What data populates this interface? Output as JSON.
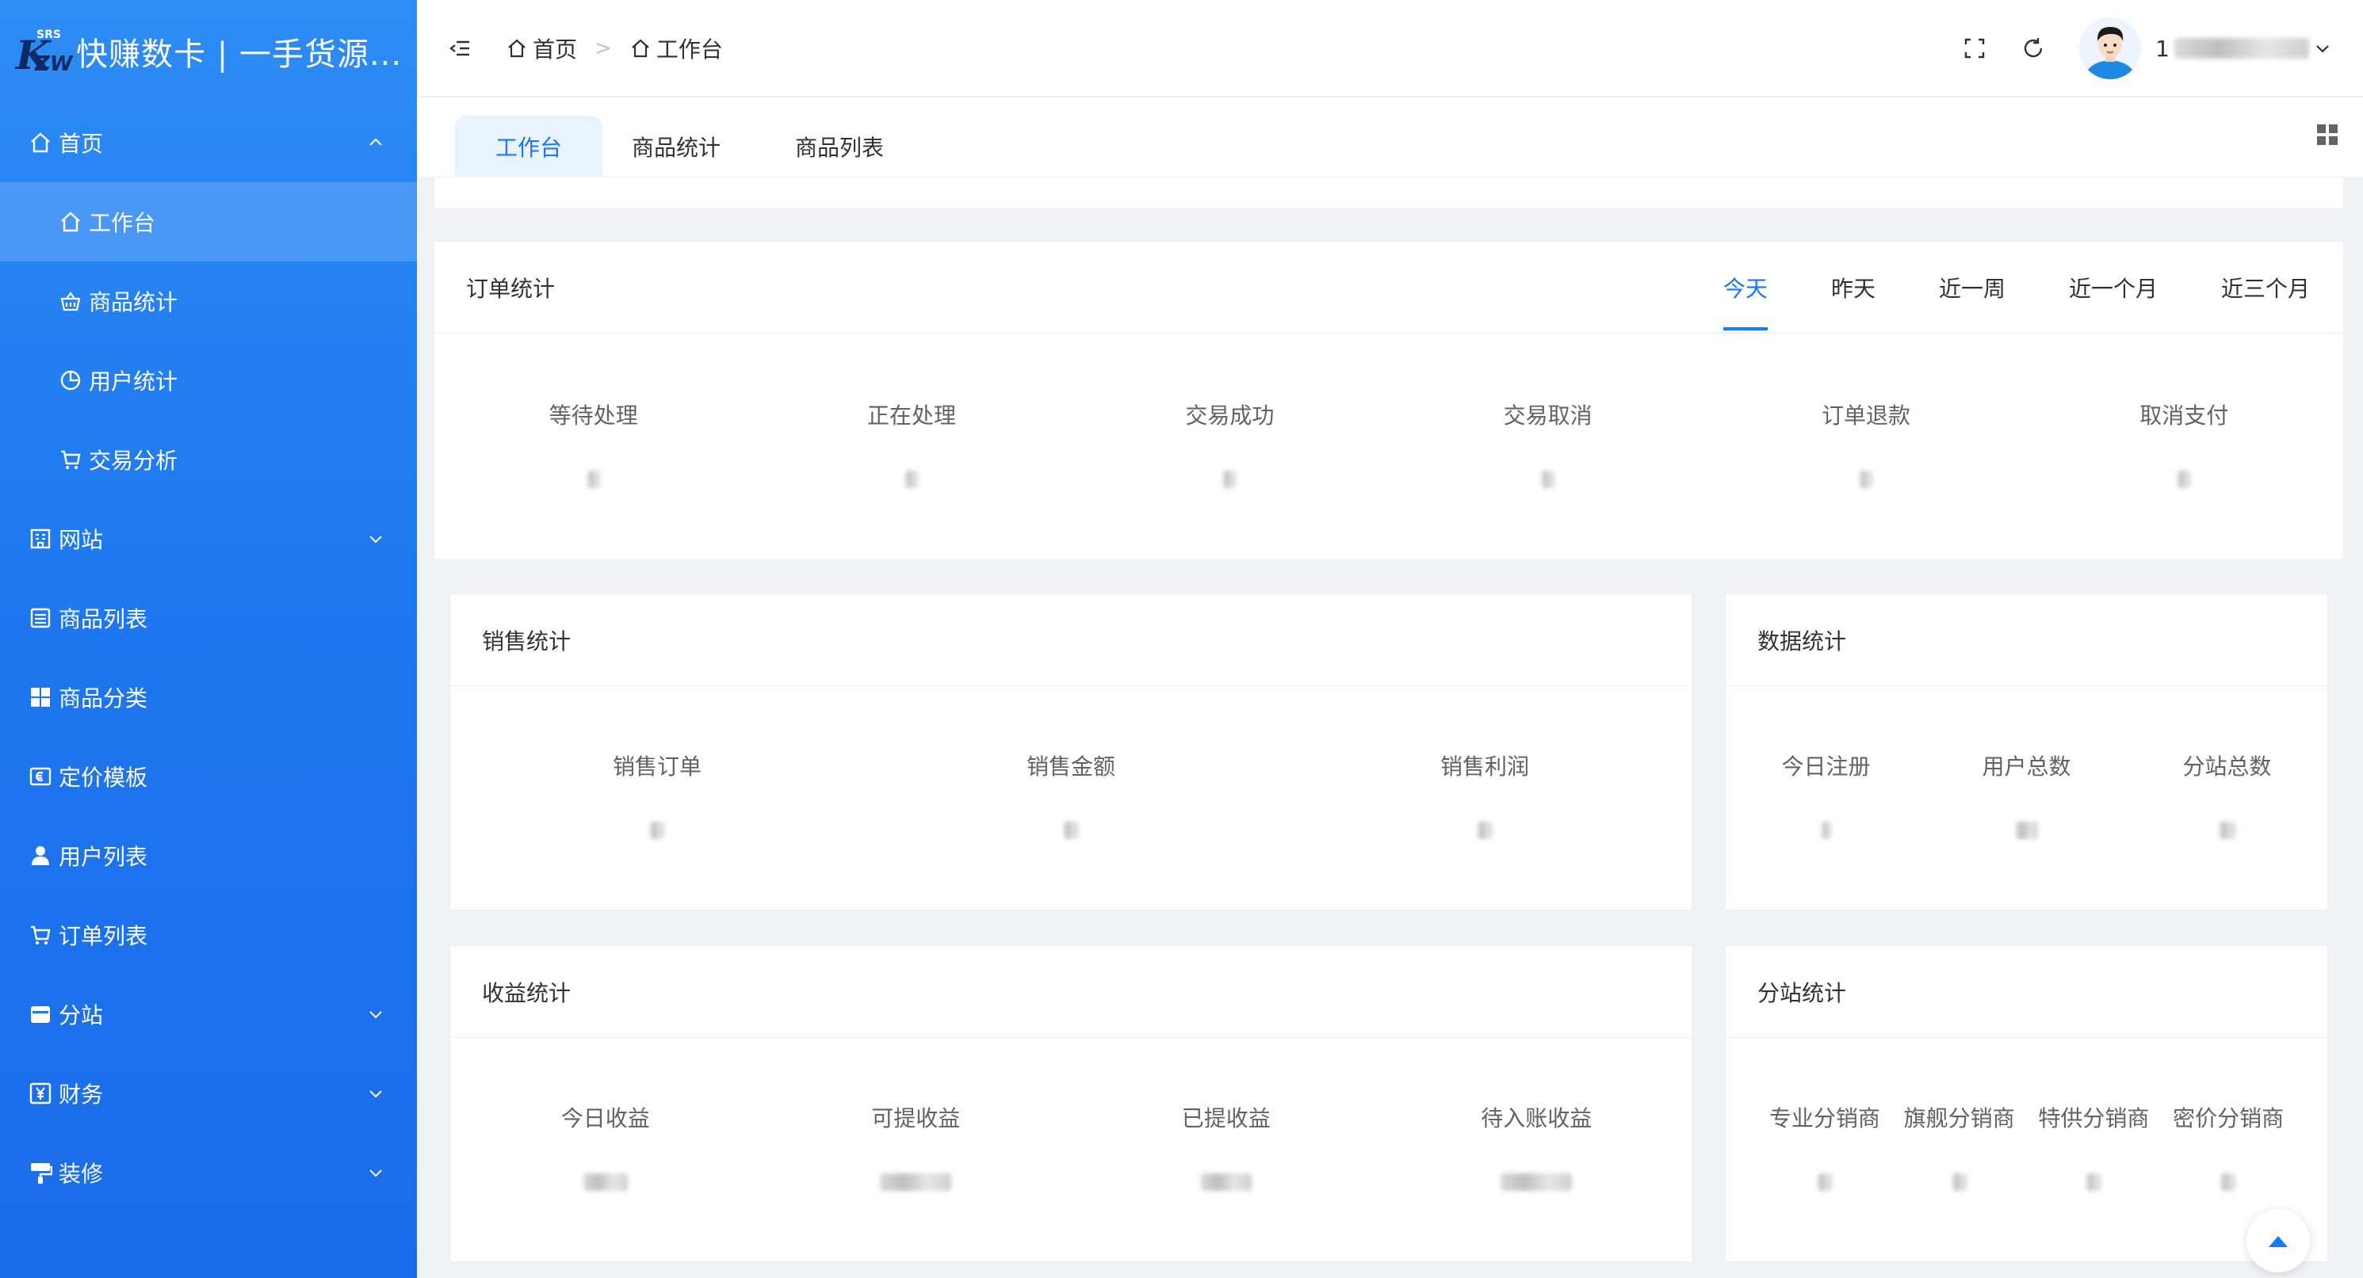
{
  "app": {
    "title": "快赚数卡 | 一手货源...",
    "logo_letters": "KZW",
    "logo_small": "SRS"
  },
  "sidebar": {
    "items": [
      {
        "label": "首页",
        "icon": "home-icon",
        "expanded": true
      },
      {
        "label": "工作台",
        "icon": "home-icon",
        "active": true
      },
      {
        "label": "商品统计",
        "icon": "basket-icon"
      },
      {
        "label": "用户统计",
        "icon": "pie-chart-icon"
      },
      {
        "label": "交易分析",
        "icon": "cart-icon"
      },
      {
        "label": "网站",
        "icon": "office-building-icon",
        "has_children": true
      },
      {
        "label": "商品列表",
        "icon": "list-icon"
      },
      {
        "label": "商品分类",
        "icon": "grid-icon"
      },
      {
        "label": "定价模板",
        "icon": "money-icon"
      },
      {
        "label": "用户列表",
        "icon": "user-icon"
      },
      {
        "label": "订单列表",
        "icon": "cart-icon"
      },
      {
        "label": "分站",
        "icon": "wallet-icon",
        "has_children": true
      },
      {
        "label": "财务",
        "icon": "yuan-icon",
        "has_children": true
      },
      {
        "label": "装修",
        "icon": "brush-icon",
        "has_children": true
      }
    ]
  },
  "header": {
    "breadcrumb": [
      "首页",
      "工作台"
    ],
    "user_name": "1"
  },
  "tabs": [
    {
      "label": "工作台",
      "active": true
    },
    {
      "label": "商品统计"
    },
    {
      "label": "商品列表"
    }
  ],
  "order_stats": {
    "title": "订单统计",
    "periods": [
      "今天",
      "昨天",
      "近一周",
      "近一个月",
      "近三个月"
    ],
    "active_period": "今天",
    "items": [
      "等待处理",
      "正在处理",
      "交易成功",
      "交易取消",
      "订单退款",
      "取消支付"
    ]
  },
  "sales_stats": {
    "title": "销售统计",
    "items": [
      "销售订单",
      "销售金额",
      "销售利润"
    ]
  },
  "data_stats": {
    "title": "数据统计",
    "items": [
      "今日注册",
      "用户总数",
      "分站总数"
    ]
  },
  "income_stats": {
    "title": "收益统计",
    "items": [
      "今日收益",
      "可提收益",
      "已提收益",
      "待入账收益"
    ]
  },
  "branch_stats": {
    "title": "分站统计",
    "items": [
      "专业分销商",
      "旗舰分销商",
      "特供分销商",
      "密价分销商"
    ]
  },
  "colors": {
    "primary": "#1677ff",
    "sidebar_top": "#2e8cf5",
    "sidebar_bottom": "#1b6cea"
  }
}
